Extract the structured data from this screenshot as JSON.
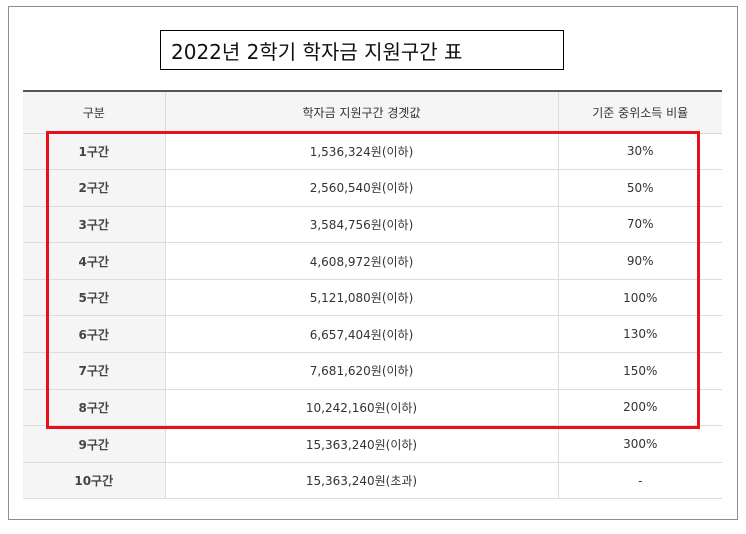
{
  "title": "2022년 2학기 학자금 지원구간 표",
  "table": {
    "headers": [
      "구분",
      "학자금 지원구간 경곗값",
      "기준 중위소득 비율"
    ],
    "rows": [
      {
        "category": "1구간",
        "threshold": "1,536,324원(이하)",
        "ratio": "30%"
      },
      {
        "category": "2구간",
        "threshold": "2,560,540원(이하)",
        "ratio": "50%"
      },
      {
        "category": "3구간",
        "threshold": "3,584,756원(이하)",
        "ratio": "70%"
      },
      {
        "category": "4구간",
        "threshold": "4,608,972원(이하)",
        "ratio": "90%"
      },
      {
        "category": "5구간",
        "threshold": "5,121,080원(이하)",
        "ratio": "100%"
      },
      {
        "category": "6구간",
        "threshold": "6,657,404원(이하)",
        "ratio": "130%"
      },
      {
        "category": "7구간",
        "threshold": "7,681,620원(이하)",
        "ratio": "150%"
      },
      {
        "category": "8구간",
        "threshold": "10,242,160원(이하)",
        "ratio": "200%"
      },
      {
        "category": "9구간",
        "threshold": "15,363,240원(이하)",
        "ratio": "300%"
      },
      {
        "category": "10구간",
        "threshold": "15,363,240원(초과)",
        "ratio": "-"
      }
    ]
  },
  "highlight_color": "#e8101a"
}
